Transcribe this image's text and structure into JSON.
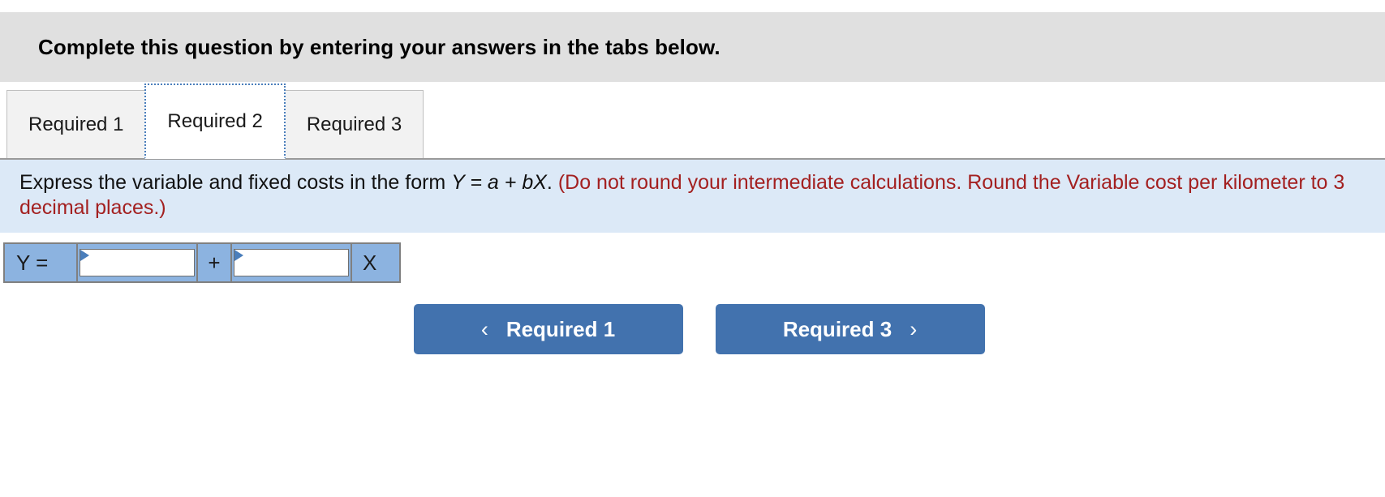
{
  "banner": {
    "text": "Complete this question by entering your answers in the tabs below."
  },
  "tabs": {
    "active_index": 1,
    "items": [
      {
        "label": "Required 1"
      },
      {
        "label": "Required 2"
      },
      {
        "label": "Required 3"
      }
    ]
  },
  "prompt": {
    "lead": "Express the variable and fixed costs in the form ",
    "formula": "Y = a + bX",
    "formula_period": ". ",
    "note": "(Do not round your intermediate calculations. Round the Variable cost per kilometer to 3 decimal places.)"
  },
  "answer": {
    "y_label": "Y =",
    "operator": "+",
    "x_label": "X",
    "intercept_value": "",
    "intercept_placeholder": "",
    "slope_value": "",
    "slope_placeholder": ""
  },
  "navigation": {
    "prev": {
      "label": "Required 1",
      "icon": "‹"
    },
    "next": {
      "label": "Required 3",
      "icon": "›"
    }
  },
  "colors": {
    "banner_bg": "#e0e0e0",
    "prompt_bg": "#dce9f7",
    "prompt_red": "#a32020",
    "cell_blue": "#8cb3e0",
    "button_blue": "#4272ae",
    "focus_blue": "#4a7ebb"
  }
}
